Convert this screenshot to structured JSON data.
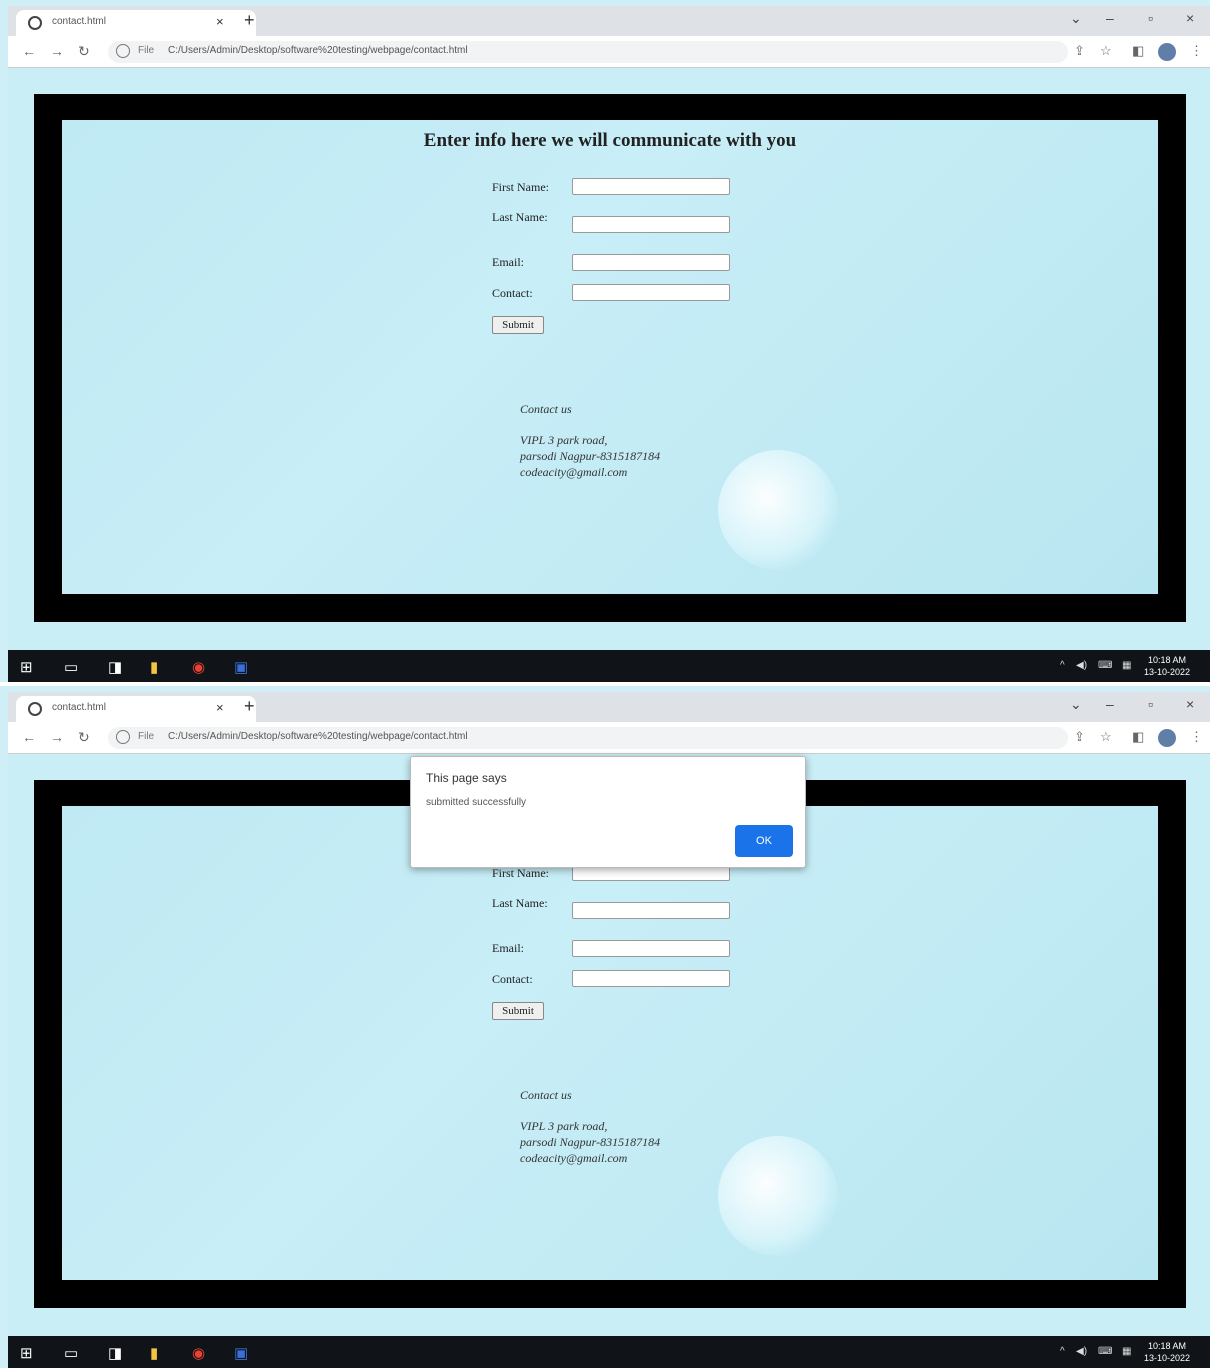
{
  "browser": {
    "tab_title": "contact.html",
    "url_scheme": "File",
    "url": "C:/Users/Admin/Desktop/software%20testing/webpage/contact.html"
  },
  "page": {
    "heading": "Enter info here we will communicate with you",
    "fields": {
      "first_name_label": "First Name:",
      "last_name_label": "Last Name:",
      "email_label": "Email:",
      "contact_label": "Contact:"
    },
    "submit_label": "Submit",
    "contact_heading": "Contact us",
    "address_line1": "VIPL 3 park road,",
    "address_line2": "parsodi Nagpur-8315187184",
    "address_line3": "codeacity@gmail.com"
  },
  "taskbar": {
    "clock_time": "10:18 AM",
    "clock_date": "13-10-2022"
  },
  "alert": {
    "title": "This page says",
    "message": "submitted successfully",
    "ok_label": "OK"
  },
  "colors": {
    "page_bg": "#c9eef6",
    "frame": "#000000",
    "ok_button": "#1a73e8"
  }
}
